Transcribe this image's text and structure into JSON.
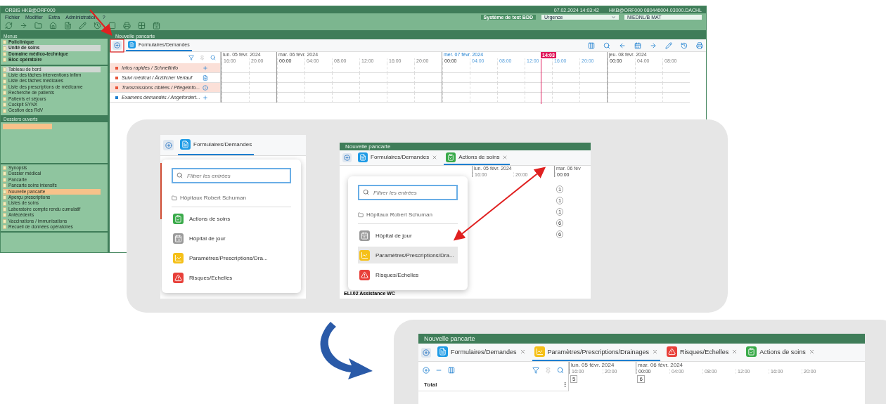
{
  "main_window": {
    "title": "ORBIS HKB@ORF000",
    "datetime": "07.02.2024 14:03:42",
    "user": "HKB@ORF000 080446004.03000.DACHL",
    "menu": [
      "Fichier",
      "Modifier",
      "Extra",
      "Administration",
      "?"
    ],
    "test_system": "Système de test BDD",
    "unit": "Urgence",
    "ward": "NIEDNL/B MAT",
    "sidebar": {
      "title": "Menus",
      "groups": [
        {
          "label": "Policlinique",
          "selected": false
        },
        {
          "label": "Unité de soins",
          "selected": true
        },
        {
          "label": "Domaine médico-technique",
          "selected": false
        },
        {
          "label": "Bloc opératoire",
          "selected": false
        }
      ],
      "items": [
        {
          "label": "Tableau de bord",
          "selected": true
        },
        {
          "label": "Liste des tâches interventions infirm",
          "selected": false
        },
        {
          "label": "Liste des tâches médicales",
          "selected": false
        },
        {
          "label": "Liste des prescriptions de médicame",
          "selected": false
        },
        {
          "label": "Recherche de patients",
          "selected": false
        },
        {
          "label": "Patients et séjours",
          "selected": false
        },
        {
          "label": "Cockpit SYNX",
          "selected": false
        },
        {
          "label": "Gestion des RdV",
          "selected": false
        }
      ],
      "open_files_title": "Dossiers ouverts",
      "documents": [
        {
          "label": "Synopsis",
          "selected": false
        },
        {
          "label": "Dossier médical",
          "selected": false
        },
        {
          "label": "Pancarte",
          "selected": false
        },
        {
          "label": "Pancarte soins intensifs",
          "selected": false
        },
        {
          "label": "Nouvelle pancarte",
          "selected": true
        },
        {
          "label": "Aperçu prescriptions",
          "selected": false
        },
        {
          "label": "Listes de soins",
          "selected": false
        },
        {
          "label": "Laboratoire compte rendu cumulatif",
          "selected": false
        },
        {
          "label": "Antécédents",
          "selected": false
        },
        {
          "label": "Vaccinations / immunisations",
          "selected": false
        },
        {
          "label": "Recueil de données opératoires",
          "selected": false
        }
      ]
    },
    "chart_panel": {
      "title": "Nouvelle pancarte",
      "tabs": [
        {
          "label": "Formulaires/Demandes",
          "kind": "form",
          "color": "#1e9be6",
          "selected": true
        }
      ],
      "days": [
        {
          "label": "lun. 05 févr. 2024",
          "hours": [
            "16:00",
            "20:00"
          ],
          "current": false
        },
        {
          "label": "mar. 06 févr. 2024",
          "hours": [
            "00:00",
            "04:00",
            "08:00",
            "12:00",
            "16:00",
            "20:00"
          ],
          "current": false
        },
        {
          "label": "mer. 07 févr. 2024",
          "hours": [
            "00:00",
            "04:00",
            "08:00",
            "12:00",
            "16:00",
            "20:00"
          ],
          "current": true
        },
        {
          "label": "jeu. 08 févr. 2024",
          "hours": [
            "00:00",
            "04:00",
            "08:00"
          ],
          "current": false
        }
      ],
      "now": "14:03",
      "rows": [
        {
          "label": "Infos rapides / Schnellinfo",
          "color": "#e8553a",
          "kind": "add",
          "highlighted": true
        },
        {
          "label": "Suivi médical / Ärztlicher Verlauf",
          "color": "#e8553a",
          "kind": "document",
          "highlighted": false
        },
        {
          "label": "Transmissions ciblées / Pflegeinfo...",
          "color": "#e8553a",
          "kind": "info",
          "highlighted": true
        },
        {
          "label": "Examens demandés / Angefordert...",
          "color": "#1e7fd0",
          "kind": "add",
          "highlighted": false
        }
      ]
    }
  },
  "inset_menu": {
    "tabs": [
      {
        "label": "Formulaires/Demandes",
        "kind": "form",
        "color": "#1e9be6",
        "selected": true
      }
    ],
    "filter_placeholder": "Filtrer les entrées",
    "group": "Hôpitaux Robert Schuman",
    "items": [
      {
        "label": "Actions de soins",
        "kind": "care",
        "color": "#3aaa4a",
        "selected": false
      },
      {
        "label": "Hôpital de jour",
        "kind": "day",
        "color": "#9a9a9a",
        "selected": false
      },
      {
        "label": "Paramètres/Prescriptions/Dra...",
        "kind": "chart",
        "color": "#f5c018",
        "selected": false
      },
      {
        "label": "Risques/Echelles",
        "kind": "risk",
        "color": "#e8403a",
        "selected": false
      }
    ]
  },
  "inset_added": {
    "title": "Nouvelle pancarte",
    "tabs": [
      {
        "label": "Formulaires/Demandes",
        "kind": "form",
        "color": "#1e9be6",
        "selected": false
      },
      {
        "label": "Actions de soins",
        "kind": "care",
        "color": "#3aaa4a",
        "selected": true
      }
    ],
    "days": [
      {
        "label": "lun. 05 févr. 2024",
        "hours": [
          "16:00",
          "20:00"
        ],
        "current": false
      },
      {
        "label": "mar. 06 fév",
        "hours": [
          "00:00"
        ],
        "current": false
      }
    ],
    "filter_placeholder": "Filtrer les entrées",
    "group": "Hôpitaux Robert Schuman",
    "items": [
      {
        "label": "Hôpital de jour",
        "kind": "day",
        "color": "#9a9a9a",
        "selected": false
      },
      {
        "label": "Paramètres/Prescriptions/Dra...",
        "kind": "chart",
        "color": "#f5c018",
        "selected": true
      },
      {
        "label": "Risques/Echelles",
        "kind": "risk",
        "color": "#e8403a",
        "selected": false
      }
    ],
    "values": [
      "1",
      "1",
      "1",
      "6",
      "6"
    ],
    "row_label": "ELI.02 Assistance WC"
  },
  "result": {
    "title": "Nouvelle pancarte",
    "tabs": [
      {
        "label": "Formulaires/Demandes",
        "kind": "form",
        "color": "#1e9be6",
        "selected": false
      },
      {
        "label": "Paramètres/Prescriptions/Drainages",
        "kind": "chart",
        "color": "#f5c018",
        "selected": true
      },
      {
        "label": "Risques/Echelles",
        "kind": "risk",
        "color": "#e8403a",
        "selected": false
      },
      {
        "label": "Actions de soins",
        "kind": "care",
        "color": "#3aaa4a",
        "selected": false
      }
    ],
    "days": [
      {
        "label": "lun. 05 févr. 2024",
        "hours": [
          "16:00",
          "20:00"
        ],
        "current": false
      },
      {
        "label": "mar. 06 févr. 2024",
        "hours": [
          "00:00",
          "04:00",
          "08:00",
          "12:00",
          "16:00",
          "20:00"
        ],
        "current": false
      }
    ],
    "row_label": "Total",
    "values": [
      "5",
      "6"
    ]
  }
}
